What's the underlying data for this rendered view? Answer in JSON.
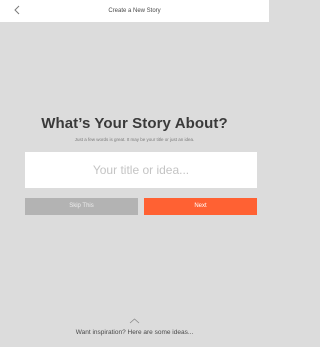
{
  "nav": {
    "title": "Create a New Story",
    "back_icon": "chevron-left-icon"
  },
  "prompt": {
    "heading": "What’s Your Story About?",
    "subheading": "Just a few words is great. It may be your title or just an idea."
  },
  "title_input": {
    "placeholder": "Your title or idea...",
    "value": ""
  },
  "actions": {
    "skip_label": "Skip This",
    "next_label": "Next"
  },
  "inspiration": {
    "icon": "chevron-up-icon",
    "label": "Want inspiration? Here are some ideas..."
  },
  "colors": {
    "background": "#dcdcdc",
    "accent": "#ff6133",
    "secondary_button": "#b3b3b3"
  }
}
